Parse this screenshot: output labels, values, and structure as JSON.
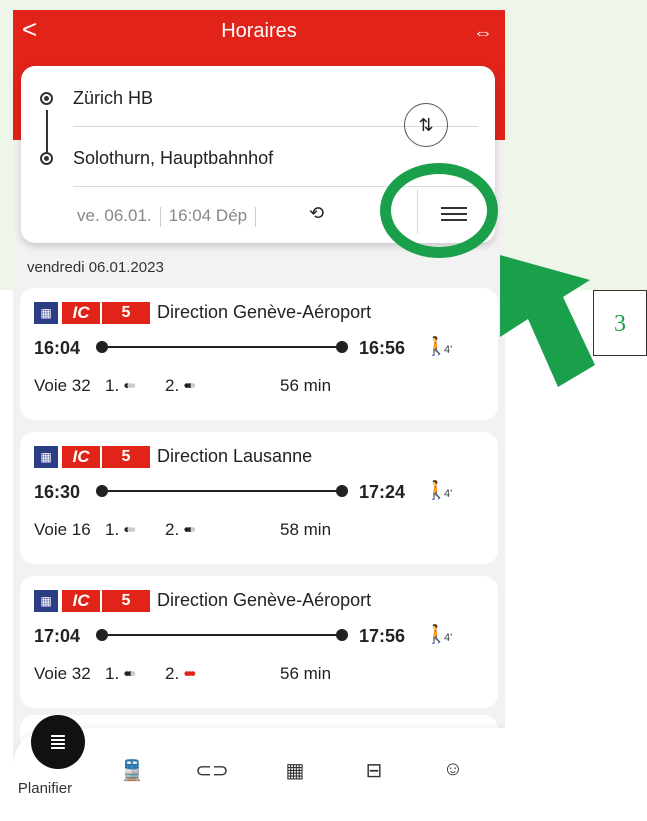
{
  "header": {
    "title": "Horaires",
    "back_glyph": "<",
    "logo_glyph": "⇔"
  },
  "search": {
    "from": "Zürich HB",
    "to": "Solothurn, Hauptbahnhof",
    "date": "ve. 06.01.",
    "time": "16:04 Dép"
  },
  "date_header": "vendredi 06.01.2023",
  "connections": [
    {
      "category": "IC",
      "line": "5",
      "direction": "Direction Genève-Aéroport",
      "departure": "16:04",
      "arrival": "16:56",
      "walk": "4'",
      "platform": "Voie 32",
      "first_class": "1.",
      "second_class": "2.",
      "duration": "56 min",
      "second_high": false
    },
    {
      "category": "IC",
      "line": "5",
      "direction": "Direction Lausanne",
      "departure": "16:30",
      "arrival": "17:24",
      "walk": "4'",
      "platform": "Voie 16",
      "first_class": "1.",
      "second_class": "2.",
      "duration": "58 min",
      "second_high": false
    },
    {
      "category": "IC",
      "line": "5",
      "direction": "Direction Genève-Aéroport",
      "departure": "17:04",
      "arrival": "17:56",
      "walk": "4'",
      "platform": "Voie 32",
      "first_class": "1.",
      "second_class": "2.",
      "duration": "56 min",
      "second_high": true
    }
  ],
  "tabs": {
    "active_label": "Planifier"
  },
  "annotation": {
    "callout_number": "3"
  },
  "colors": {
    "brand_red": "#e2231a",
    "annotation_green": "#1aa04a",
    "train_icon_blue": "#2c3d88"
  }
}
